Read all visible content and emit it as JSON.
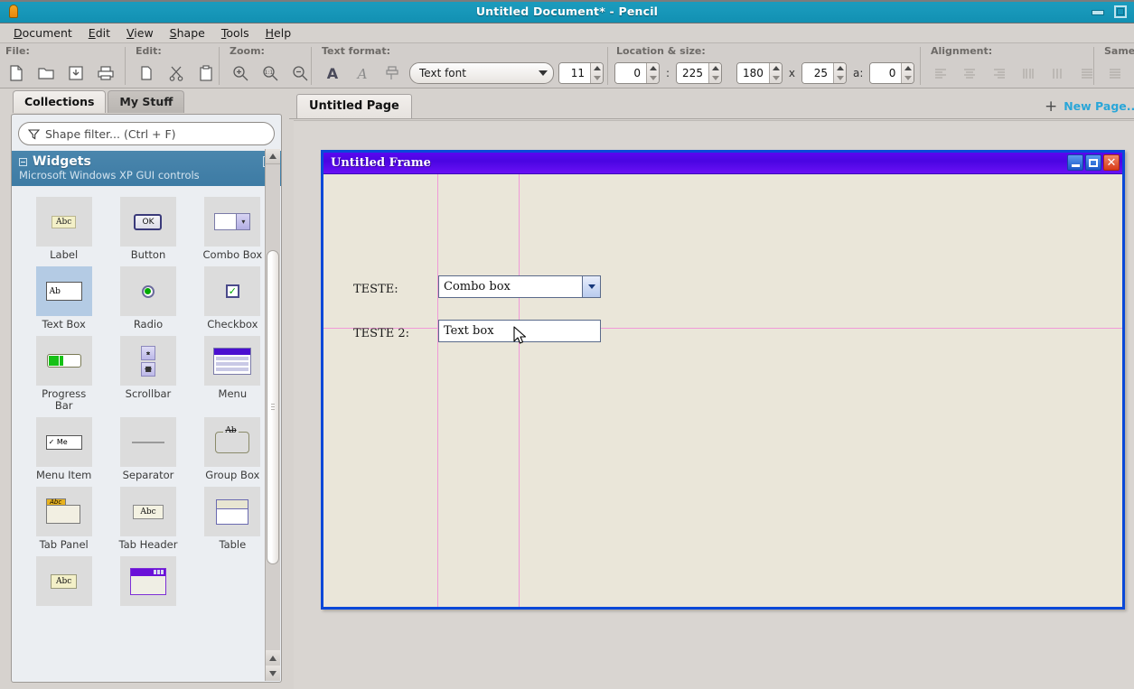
{
  "window": {
    "title": "Untitled Document* - Pencil",
    "app_icon": "pencil-icon",
    "minimize": "minimize",
    "maximize": "maximize"
  },
  "menubar": {
    "items": [
      {
        "label": "Document",
        "accel": "D"
      },
      {
        "label": "Edit",
        "accel": "E"
      },
      {
        "label": "View",
        "accel": "V"
      },
      {
        "label": "Shape",
        "accel": "S"
      },
      {
        "label": "Tools",
        "accel": "T"
      },
      {
        "label": "Help",
        "accel": "H"
      }
    ]
  },
  "toolbar": {
    "groups": {
      "file": {
        "label": "File:",
        "buttons": [
          "new-document-icon",
          "open-folder-icon",
          "save-icon",
          "print-icon"
        ]
      },
      "edit": {
        "label": "Edit:",
        "buttons": [
          "copy-icon",
          "cut-scissors-icon",
          "paste-icon"
        ]
      },
      "zoom": {
        "label": "Zoom:",
        "buttons": [
          "zoom-in-icon",
          "zoom-100-icon",
          "zoom-out-icon"
        ]
      },
      "text_format": {
        "label": "Text format:",
        "buttons": [
          "bold-a-icon",
          "italic-a-icon",
          "format-painter-icon"
        ],
        "font_name": "Text font",
        "font_size": "11"
      },
      "location_size": {
        "label": "Location & size:",
        "x": "0",
        "separator": ":",
        "y": "225",
        "width": "180",
        "times": "x",
        "height": "25",
        "angle_label": "a:",
        "angle": "0"
      },
      "alignment": {
        "label": "Alignment:",
        "buttons": [
          "align-left-icon",
          "align-center-icon",
          "align-right-icon",
          "distribute-horizontal-icon",
          "distribute-vertical-icon",
          "align-justify-icon"
        ]
      },
      "same": {
        "label": "Same",
        "buttons": [
          "same-size-icon"
        ]
      }
    }
  },
  "sidebar": {
    "tabs": [
      {
        "label": "Collections",
        "active": true
      },
      {
        "label": "My Stuff",
        "active": false
      }
    ],
    "filter_placeholder": "Shape filter... (Ctrl + F)",
    "filter_icon": "filter-funnel-icon",
    "collection": {
      "name": "Widgets",
      "subtitle": "Microsoft Windows XP GUI controls",
      "collapse_icon": "collapse-minus-icon",
      "close_icon": "close-collection-icon"
    },
    "shapes": [
      {
        "label": "Label",
        "icon": "label-shape-icon",
        "selected": false
      },
      {
        "label": "Button",
        "icon": "button-shape-icon",
        "selected": false
      },
      {
        "label": "Combo Box",
        "icon": "combobox-shape-icon",
        "selected": false
      },
      {
        "label": "Text Box",
        "icon": "textbox-shape-icon",
        "selected": true
      },
      {
        "label": "Radio",
        "icon": "radio-shape-icon",
        "selected": false
      },
      {
        "label": "Checkbox",
        "icon": "checkbox-shape-icon",
        "selected": false
      },
      {
        "label": "Progress Bar",
        "icon": "progressbar-shape-icon",
        "selected": false
      },
      {
        "label": "Scrollbar",
        "icon": "scrollbar-shape-icon",
        "selected": false
      },
      {
        "label": "Menu",
        "icon": "menu-shape-icon",
        "selected": false
      },
      {
        "label": "Menu Item",
        "icon": "menuitem-shape-icon",
        "selected": false
      },
      {
        "label": "Separator",
        "icon": "separator-shape-icon",
        "selected": false
      },
      {
        "label": "Group Box",
        "icon": "groupbox-shape-icon",
        "selected": false
      },
      {
        "label": "Tab Panel",
        "icon": "tabpanel-shape-icon",
        "selected": false
      },
      {
        "label": "Tab Header",
        "icon": "tabheader-shape-icon",
        "selected": false
      },
      {
        "label": "Table",
        "icon": "table-shape-icon",
        "selected": false
      },
      {
        "label": "",
        "icon": "editable-label-shape-icon",
        "selected": false
      },
      {
        "label": "",
        "icon": "window-shape-icon",
        "selected": false
      }
    ]
  },
  "main": {
    "page_tab": "Untitled Page",
    "new_page_label": "New Page...",
    "new_page_icon": "plus-icon"
  },
  "canvas": {
    "frame": {
      "title": "Untitled Frame",
      "minimize_icon": "frame-minimize-icon",
      "maximize_icon": "frame-maximize-icon",
      "close_icon": "frame-close-icon"
    },
    "widgets": [
      {
        "type": "label",
        "text": "TESTE:"
      },
      {
        "type": "combobox",
        "text": "Combo box",
        "arrow_icon": "chevron-down-icon"
      },
      {
        "type": "label",
        "text": "TESTE 2:"
      },
      {
        "type": "textbox",
        "text": "Text box"
      }
    ],
    "cursor_icon": "mouse-pointer-icon"
  },
  "colors": {
    "titlebar": "#1898ba",
    "accent_link": "#2aa6d8",
    "collection_header": "#43809f",
    "frame_border": "#0a48d8",
    "frame_titlebar": "#5a07f0",
    "canvas_bg": "#eae6d9",
    "guide_line": "#f09ad8",
    "selection": "#b4cbe4"
  }
}
